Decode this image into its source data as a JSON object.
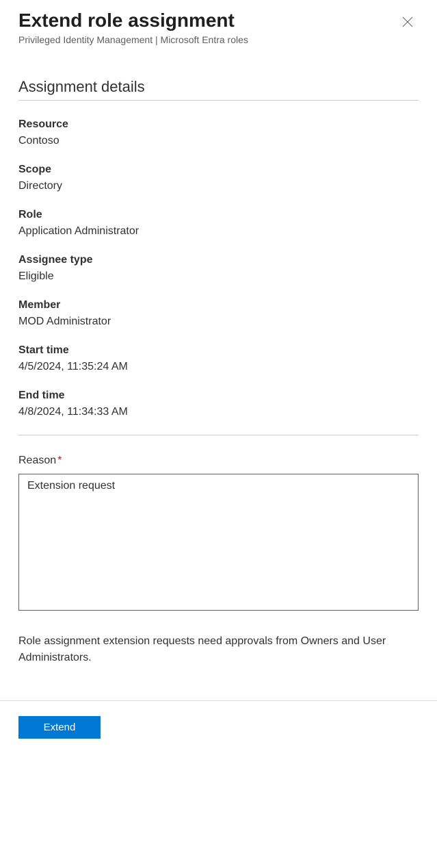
{
  "header": {
    "title": "Extend role assignment",
    "subtitle": "Privileged Identity Management | Microsoft Entra roles"
  },
  "section": {
    "title": "Assignment details"
  },
  "fields": {
    "resource": {
      "label": "Resource",
      "value": "Contoso"
    },
    "scope": {
      "label": "Scope",
      "value": "Directory"
    },
    "role": {
      "label": "Role",
      "value": "Application Administrator"
    },
    "assignee_type": {
      "label": "Assignee type",
      "value": "Eligible"
    },
    "member": {
      "label": "Member",
      "value": "MOD Administrator"
    },
    "start_time": {
      "label": "Start time",
      "value": "4/5/2024, 11:35:24 AM"
    },
    "end_time": {
      "label": "End time",
      "value": "4/8/2024, 11:34:33 AM"
    }
  },
  "reason": {
    "label": "Reason",
    "required_marker": "*",
    "value": "Extension request"
  },
  "info_text": "Role assignment extension requests need approvals from Owners and User Administrators.",
  "footer": {
    "extend_label": "Extend"
  }
}
